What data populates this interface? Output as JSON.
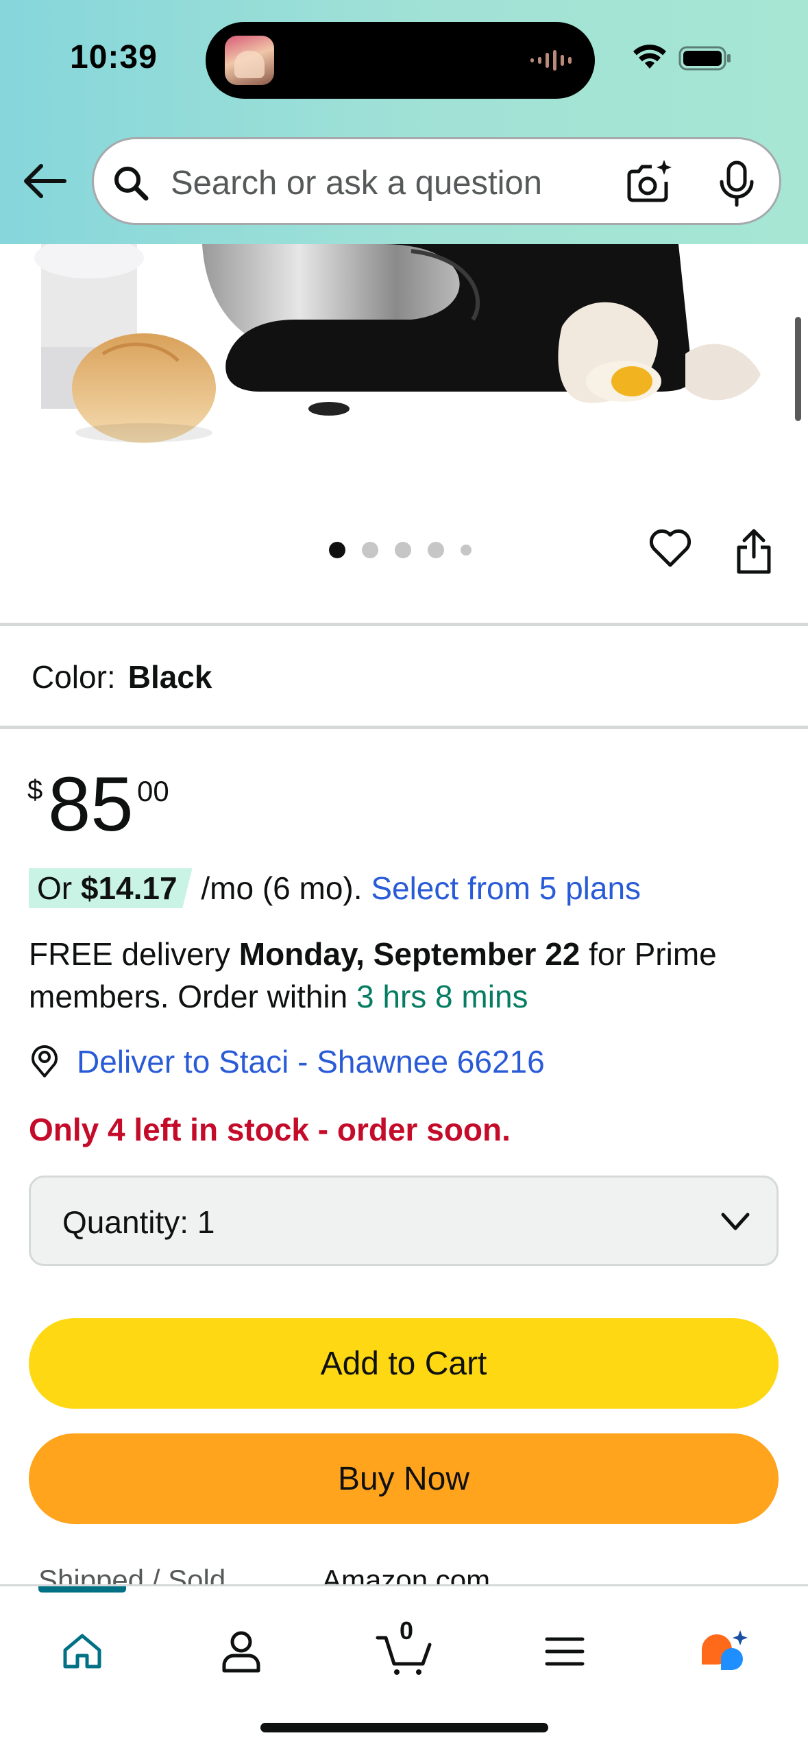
{
  "status_bar": {
    "time": "10:39"
  },
  "search": {
    "placeholder": "Search or ask a question"
  },
  "gallery": {
    "image_count": 5,
    "active_index": 1
  },
  "color": {
    "label": "Color:",
    "value": "Black"
  },
  "price": {
    "symbol": "$",
    "whole": "85",
    "fraction": "00"
  },
  "installment": {
    "prefix": "Or",
    "amount": "$14.17",
    "term": "/mo (6 mo).",
    "link": "Select from 5 plans"
  },
  "delivery": {
    "free": "FREE delivery",
    "date": "Monday, September 22",
    "for_prime": "for Prime members. Order within",
    "cutoff": "3 hrs 8 mins"
  },
  "deliver_to": {
    "text": "Deliver to Staci - Shawnee 66216"
  },
  "stock": {
    "text": "Only 4 left in stock - order soon."
  },
  "quantity": {
    "label": "Quantity:",
    "value": "1"
  },
  "buttons": {
    "add_to_cart": "Add to Cart",
    "buy_now": "Buy Now"
  },
  "shipping": {
    "label": "Shipped / Sold",
    "value": "Amazon.com"
  },
  "bottom_nav": {
    "cart_count": "0",
    "items": [
      "home-icon",
      "account-icon",
      "cart-icon",
      "menu-icon",
      "rufus-icon"
    ],
    "accent": "#007185"
  },
  "colors": {
    "link": "#2a5bd7",
    "stock": "#c40c2a",
    "cutoff": "#067d62",
    "add_to_cart": "#ffd814",
    "buy_now": "#ffa41c"
  }
}
